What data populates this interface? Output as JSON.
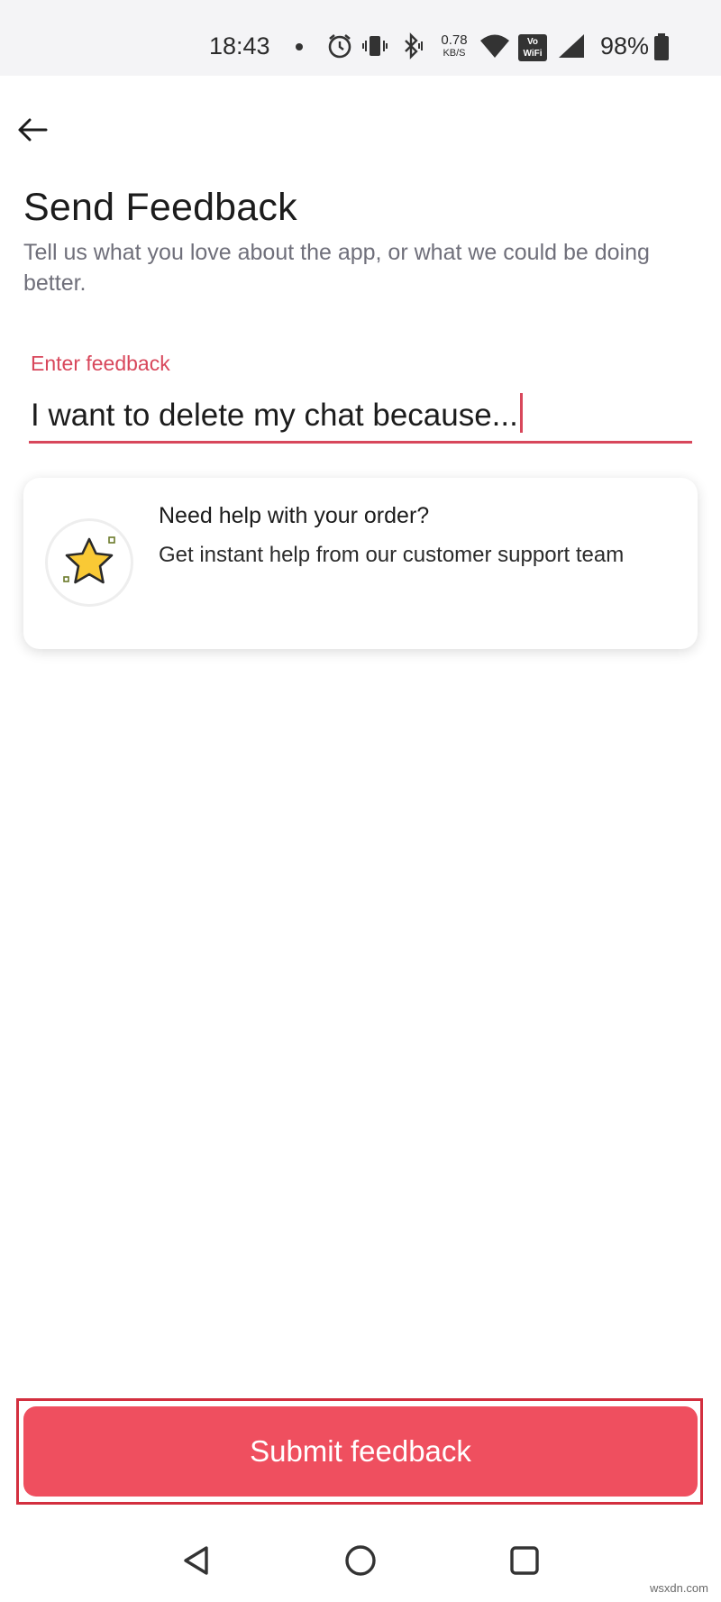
{
  "status_bar": {
    "time": "18:43",
    "net_speed_value": "0.78",
    "net_speed_unit": "KB/S",
    "vowifi_top": "Vo",
    "vowifi_bottom": "WiFi",
    "battery": "98%",
    "icons": [
      "dot-icon",
      "alarm-icon",
      "vibrate-icon",
      "bluetooth-icon",
      "wifi-icon",
      "signal-icon",
      "battery-icon"
    ]
  },
  "header": {
    "back_icon": "arrow-left-icon",
    "title": "Send Feedback",
    "subtitle": "Tell us what you love about the app, or what we could be doing better."
  },
  "feedback_input": {
    "label": "Enter feedback",
    "value": "I want to delete my chat because..."
  },
  "help_card": {
    "icon": "star-icon",
    "title": "Need help with your order?",
    "description": "Get instant help from our customer support team"
  },
  "submit": {
    "label": "Submit feedback"
  },
  "nav_bar": {
    "buttons": [
      "back-triangle-icon",
      "home-circle-icon",
      "recents-square-icon"
    ]
  },
  "watermark": "wsxdn.com",
  "colors": {
    "accent": "#ef4f5f",
    "accent_dark": "#d8475b",
    "subtitle": "#6f6f7a",
    "status_bar_bg": "#f4f4f6",
    "star_fill": "#f9c935"
  }
}
